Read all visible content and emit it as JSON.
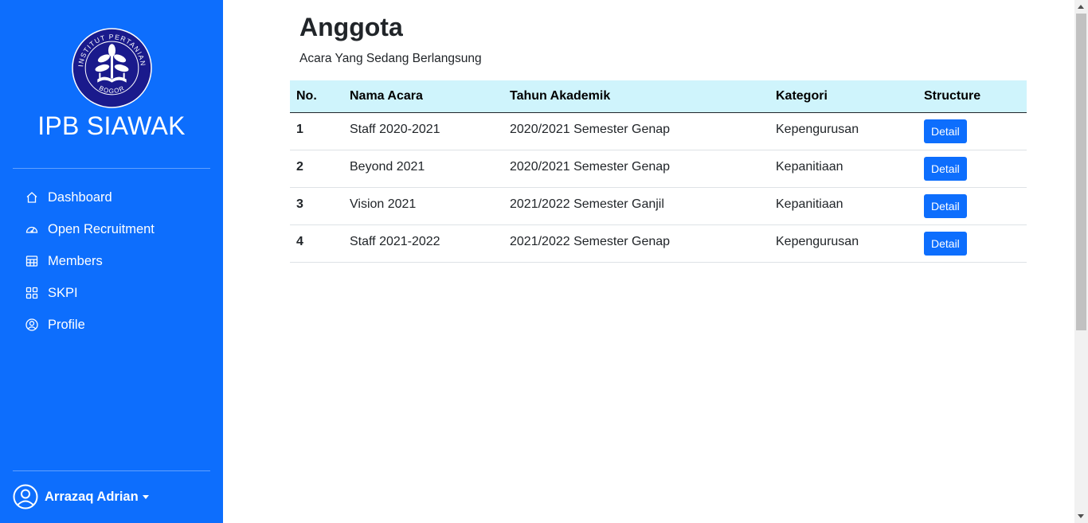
{
  "sidebar": {
    "brand": "IPB SIAWAK",
    "logo": {
      "text_top": "INSTITUT PERTANIAN",
      "text_bottom": "BOGOR",
      "color": "#1a1a8c"
    },
    "nav": [
      {
        "label": "Dashboard",
        "icon": "house-icon"
      },
      {
        "label": "Open Recruitment",
        "icon": "speedometer-icon"
      },
      {
        "label": "Members",
        "icon": "table-icon"
      },
      {
        "label": "SKPI",
        "icon": "grid-icon"
      },
      {
        "label": "Profile",
        "icon": "person-circle-icon"
      }
    ],
    "user": {
      "name": "Arrazaq Adrian",
      "icon": "person-circle-icon"
    }
  },
  "main": {
    "title": "Anggota",
    "subtitle": "Acara Yang Sedang Berlangsung",
    "table": {
      "headers": [
        "No.",
        "Nama Acara",
        "Tahun Akademik",
        "Kategori",
        "Structure"
      ],
      "rows": [
        {
          "no": "1",
          "nama": "Staff 2020-2021",
          "tahun": "2020/2021 Semester Genap",
          "kategori": "Kepengurusan",
          "action": "Detail"
        },
        {
          "no": "2",
          "nama": "Beyond 2021",
          "tahun": "2020/2021 Semester Genap",
          "kategori": "Kepanitiaan",
          "action": "Detail"
        },
        {
          "no": "3",
          "nama": "Vision 2021",
          "tahun": "2021/2022 Semester Ganjil",
          "kategori": "Kepanitiaan",
          "action": "Detail"
        },
        {
          "no": "4",
          "nama": "Staff 2021-2022",
          "tahun": "2021/2022 Semester Genap",
          "kategori": "Kepengurusan",
          "action": "Detail"
        }
      ]
    }
  },
  "colors": {
    "sidebar_bg": "#0d6efd",
    "table_header_bg": "#cff4fc",
    "button_bg": "#0d6efd"
  }
}
